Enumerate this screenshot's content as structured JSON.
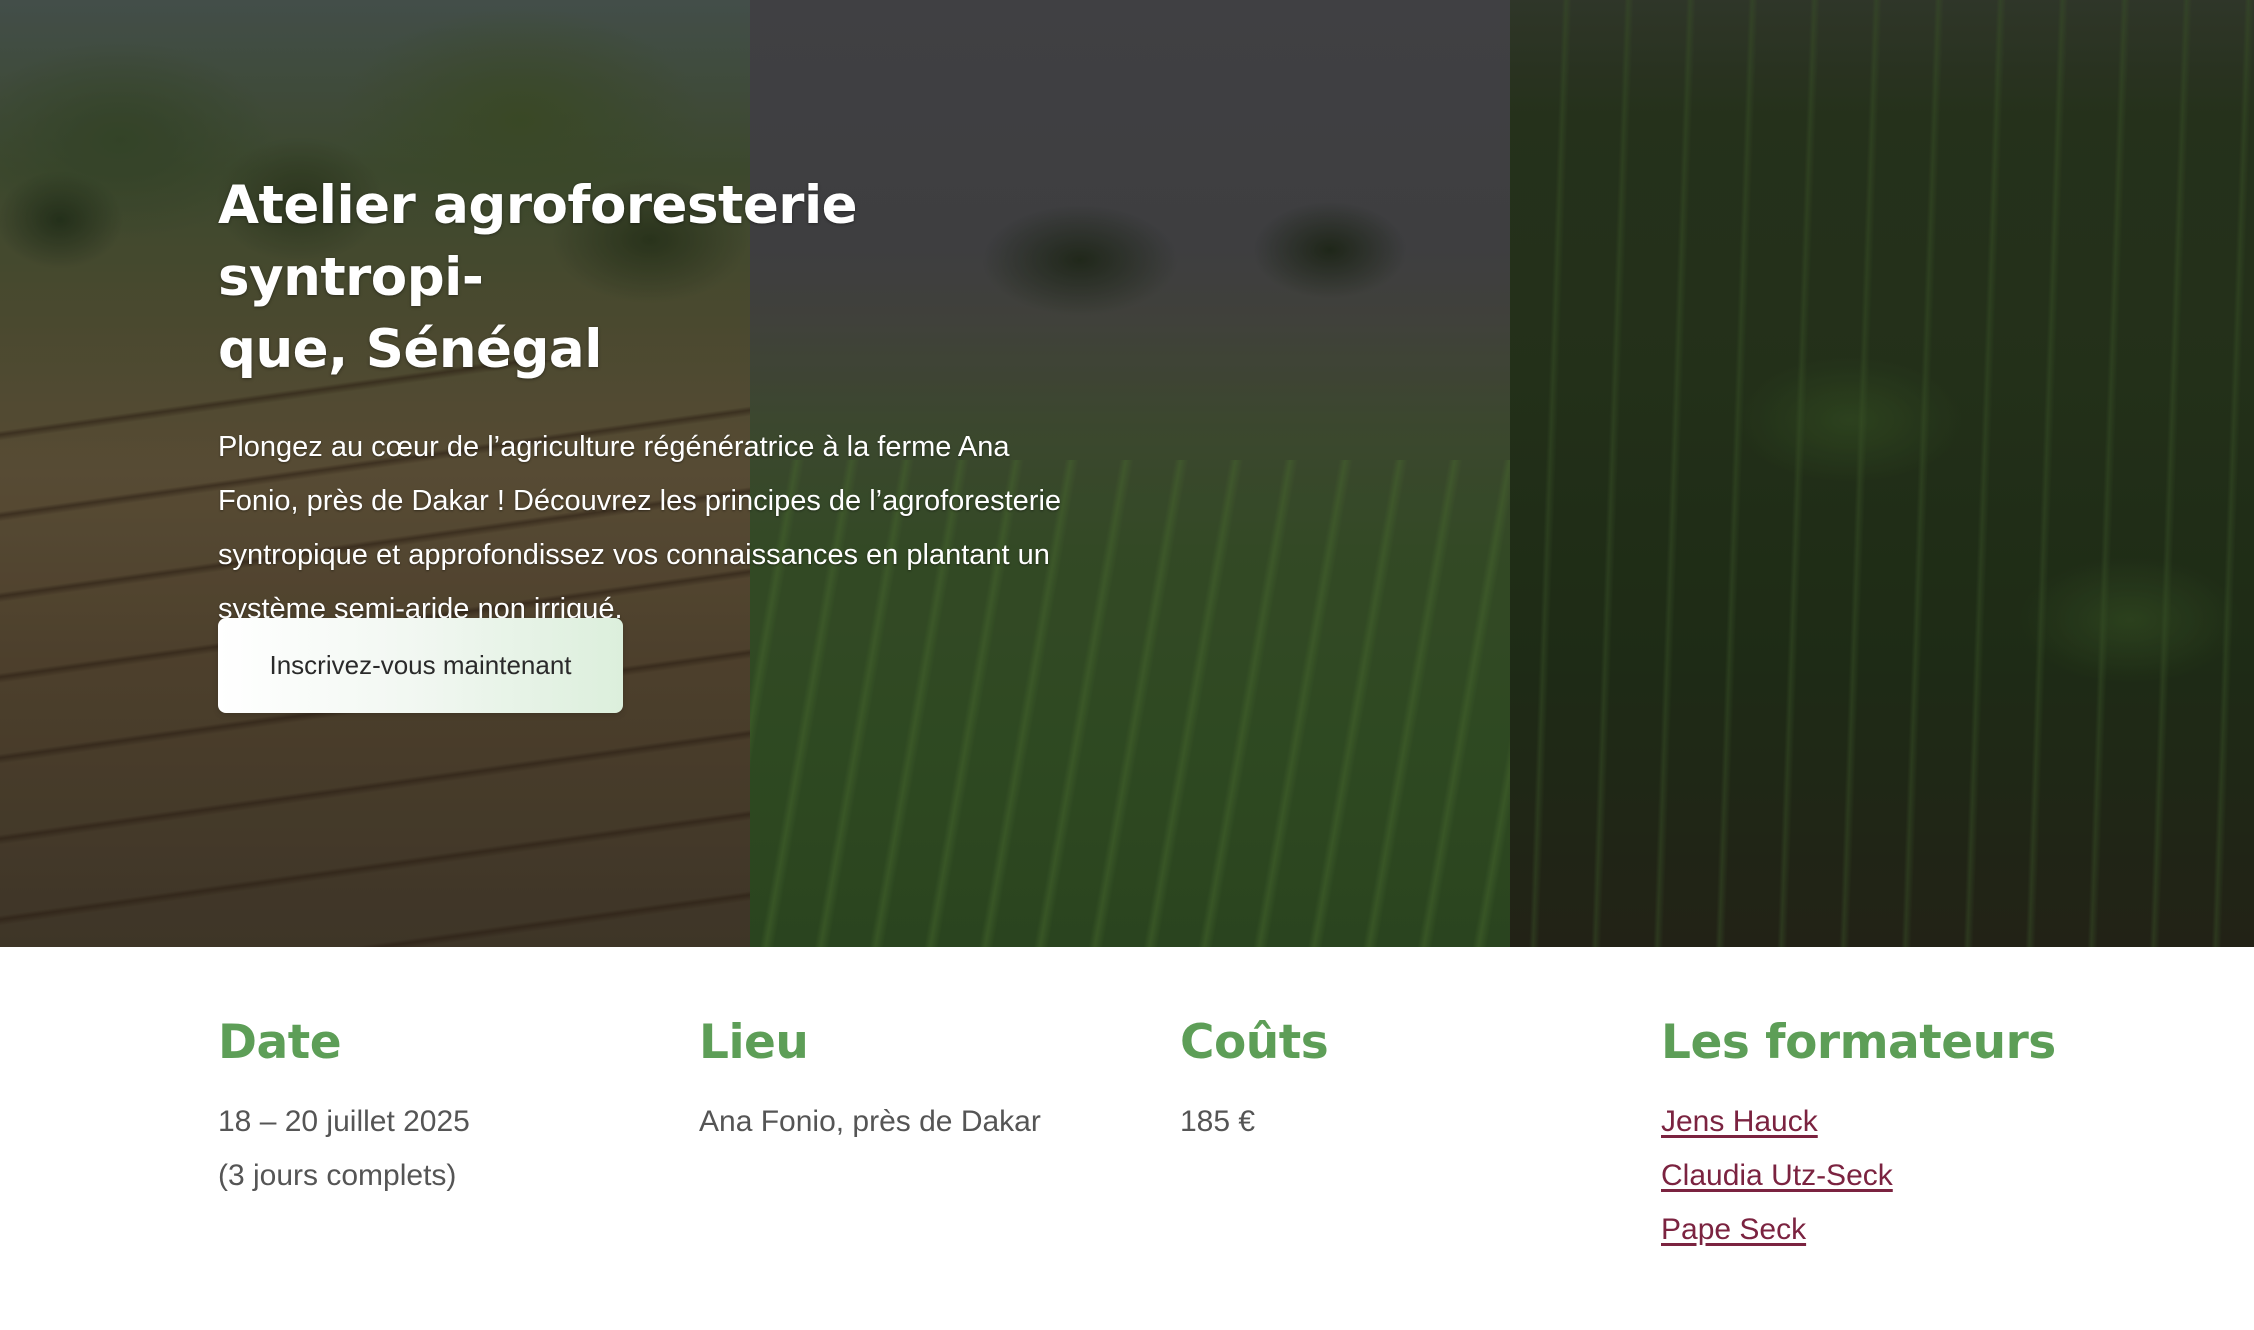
{
  "hero": {
    "title": "Atelier agroforesterie syntropi-que, Sénégal",
    "title_line1": "Atelier agroforesterie syntropi-",
    "title_line2": "que, Sénégal",
    "description": "Plongez au cœur de l’agriculture régénératrice à la ferme Ana Fonio, près de Dakar ! Découvrez les principes de l’agroforesterie syntropique et approfondissez vos connaissances en plantant un système semi-aride non irrigué.",
    "cta_label": "Inscrivez-vous maintenant"
  },
  "info": {
    "date": {
      "heading": "Date",
      "lines": [
        "18 – 20 juillet 2025",
        "(3 jours complets)"
      ]
    },
    "lieu": {
      "heading": "Lieu",
      "lines": [
        "Ana Fonio, près de Dakar"
      ]
    },
    "couts": {
      "heading": "Coûts",
      "lines": [
        "185 €"
      ]
    },
    "formateurs": {
      "heading": "Les formateurs",
      "trainers": [
        "Jens Hauck",
        "Claudia Utz-Seck",
        "Pape Seck"
      ]
    }
  },
  "colors": {
    "heading_green": "#5d9e57",
    "link_maroon": "#7b2340",
    "body_text": "#555555"
  }
}
